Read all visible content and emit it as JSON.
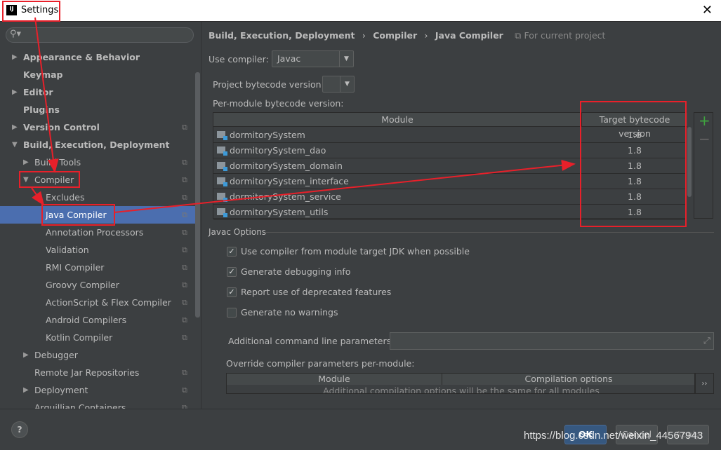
{
  "window": {
    "title": "Settings",
    "logo": "IJ",
    "close": "✕"
  },
  "sidebar": {
    "search_placeholder": "",
    "items": [
      {
        "label": "Appearance & Behavior",
        "bold": true,
        "arrow": "right",
        "level": 0
      },
      {
        "label": "Keymap",
        "bold": true,
        "level": 0
      },
      {
        "label": "Editor",
        "bold": true,
        "arrow": "right",
        "level": 0
      },
      {
        "label": "Plugins",
        "bold": true,
        "level": 0
      },
      {
        "label": "Version Control",
        "bold": true,
        "arrow": "right",
        "level": 0,
        "copy": true
      },
      {
        "label": "Build, Execution, Deployment",
        "bold": true,
        "arrow": "down",
        "level": 0
      },
      {
        "label": "Build Tools",
        "arrow": "right",
        "level": 1,
        "copy": true
      },
      {
        "label": "Compiler",
        "arrow": "down",
        "level": 1,
        "copy": true
      },
      {
        "label": "Excludes",
        "level": 2,
        "copy": true
      },
      {
        "label": "Java Compiler",
        "level": 2,
        "copy": true,
        "selected": true
      },
      {
        "label": "Annotation Processors",
        "level": 2,
        "copy": true
      },
      {
        "label": "Validation",
        "level": 2,
        "copy": true
      },
      {
        "label": "RMI Compiler",
        "level": 2,
        "copy": true
      },
      {
        "label": "Groovy Compiler",
        "level": 2,
        "copy": true
      },
      {
        "label": "ActionScript & Flex Compiler",
        "level": 2,
        "copy": true
      },
      {
        "label": "Android Compilers",
        "level": 2,
        "copy": true
      },
      {
        "label": "Kotlin Compiler",
        "level": 2,
        "copy": true
      },
      {
        "label": "Debugger",
        "arrow": "right",
        "level": 1
      },
      {
        "label": "Remote Jar Repositories",
        "level": 1,
        "copy": true
      },
      {
        "label": "Deployment",
        "arrow": "right",
        "level": 1,
        "copy": true
      },
      {
        "label": "Arquillian Containers",
        "level": 1,
        "copy": true
      }
    ]
  },
  "breadcrumb": {
    "items": [
      "Build, Execution, Deployment",
      "Compiler",
      "Java Compiler"
    ],
    "sep": "›",
    "scope": "For current project"
  },
  "compiler": {
    "label": "Use compiler:",
    "value": "Javac"
  },
  "bytecode": {
    "label": "Project bytecode version:",
    "value": ""
  },
  "per_module": {
    "label": "Per-module bytecode version:",
    "columns": [
      "Module",
      "Target bytecode version"
    ],
    "rows": [
      [
        "dormitorySystem",
        "1.8"
      ],
      [
        "dormitorySystem_dao",
        "1.8"
      ],
      [
        "dormitorySystem_domain",
        "1.8"
      ],
      [
        "dormitorySystem_interface",
        "1.8"
      ],
      [
        "dormitorySystem_service",
        "1.8"
      ],
      [
        "dormitorySystem_utils",
        "1.8"
      ]
    ],
    "add": "+",
    "remove": "−"
  },
  "javac": {
    "title": "Javac Options",
    "options": [
      {
        "label": "Use compiler from module target JDK when possible",
        "checked": true
      },
      {
        "label": "Generate debugging info",
        "checked": true
      },
      {
        "label": "Report use of deprecated features",
        "checked": true
      },
      {
        "label": "Generate no warnings",
        "checked": false
      }
    ],
    "additional_label": "Additional command line parameters:",
    "additional_value": "",
    "override_label": "Override compiler parameters per-module:",
    "override_columns": [
      "Module",
      "Compilation options"
    ],
    "override_empty": "Additional compilation options will be the same for all modules"
  },
  "buttons": {
    "help": "?",
    "ok": "OK",
    "cancel": "Cancel",
    "apply": "Apply"
  },
  "watermark": "https://blog.csdn.net/weixin_44567943",
  "colors": {
    "selection": "#4b6eaf",
    "annotation": "#e8202a",
    "add": "#3fa33f"
  }
}
